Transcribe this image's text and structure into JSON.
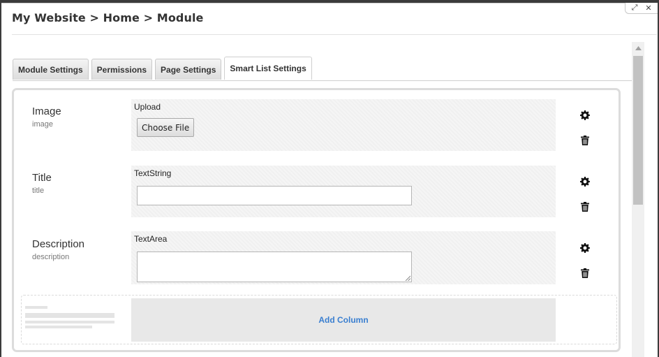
{
  "window": {
    "maximize_glyph": "⤢",
    "close_glyph": "✕"
  },
  "breadcrumb": "My Website > Home > Module",
  "tabs": [
    {
      "label": "Module Settings"
    },
    {
      "label": "Permissions"
    },
    {
      "label": "Page Settings"
    },
    {
      "label": "Smart List Settings"
    }
  ],
  "active_tab": "Smart List Settings",
  "fields": [
    {
      "name": "Image",
      "alias": "image",
      "editor": "Upload",
      "button_label": "Choose File"
    },
    {
      "name": "Title",
      "alias": "title",
      "editor": "TextString",
      "value": ""
    },
    {
      "name": "Description",
      "alias": "description",
      "editor": "TextArea",
      "value": ""
    }
  ],
  "add_column_label": "Add Column",
  "icons": {
    "settings": "gear-icon",
    "delete": "trash-icon",
    "scroll_up": "triangle-up-icon"
  },
  "colors": {
    "accent_link": "#3a7fd0",
    "editor_bg": "#f5f5f5"
  }
}
